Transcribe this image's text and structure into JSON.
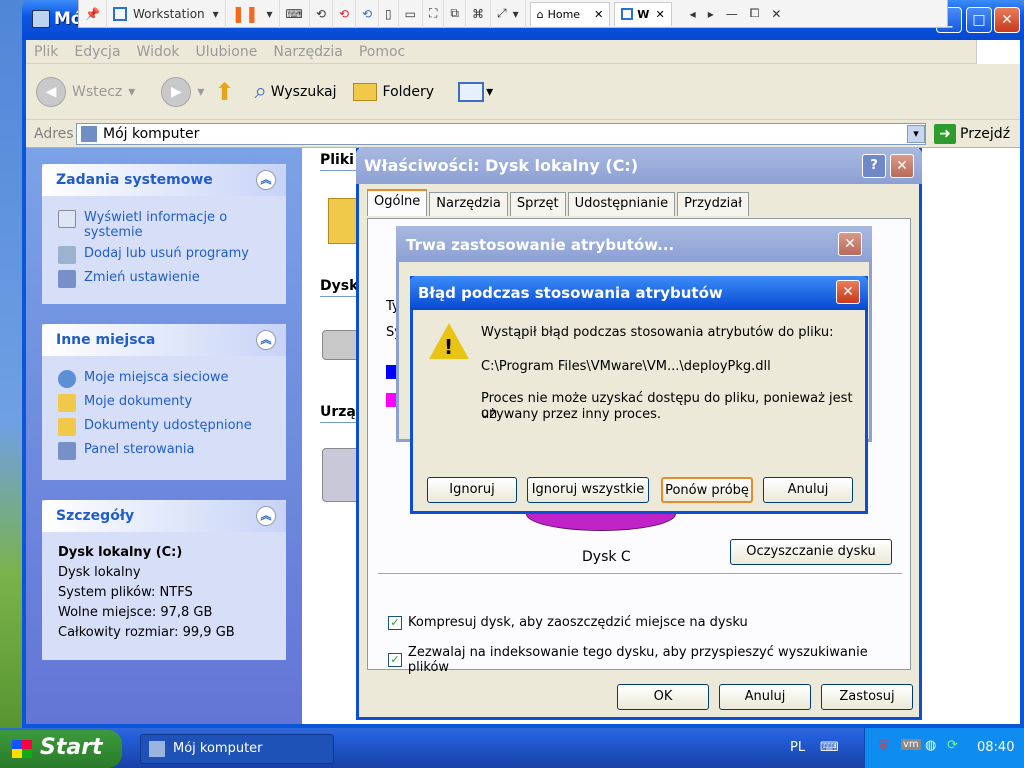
{
  "window": {
    "title": "Mó"
  },
  "vmware": {
    "vm_name": "Workstation",
    "tab_home": "Home",
    "tab_w": "W"
  },
  "menu": [
    "Plik",
    "Edycja",
    "Widok",
    "Ulubione",
    "Narzędzia",
    "Pomoc"
  ],
  "toolbar": {
    "back": "Wstecz",
    "search": "Wyszukaj",
    "folders": "Foldery"
  },
  "address": {
    "label": "Adres",
    "value": "Mój komputer",
    "go": "Przejdź"
  },
  "tasks": {
    "title": "Zadania systemowe",
    "items": [
      "Wyświetl informacje o systemie",
      "Dodaj lub usuń programy",
      "Zmień ustawienie"
    ]
  },
  "places": {
    "title": "Inne miejsca",
    "items": [
      "Moje miejsca sieciowe",
      "Moje dokumenty",
      "Dokumenty udostępnione",
      "Panel sterowania"
    ]
  },
  "details": {
    "title": "Szczegóły",
    "name": "Dysk lokalny (C:)",
    "type": "Dysk lokalny",
    "fs": "System plików: NTFS",
    "free": "Wolne miejsce: 97,8 GB",
    "total": "Całkowity rozmiar: 99,9 GB"
  },
  "content": {
    "files_header": "Pliki p",
    "drives_header": "Dysk",
    "devices_header": "Urzą"
  },
  "props": {
    "title": "Właściwości: Dysk lokalny (C:)",
    "tabs": [
      "Ogólne",
      "Narzędzia",
      "Sprzęt",
      "Udostępnianie",
      "Przydział"
    ],
    "drive_label": "Dysk C",
    "cleanup": "Oczyszczanie dysku",
    "compress": "Kompresuj dysk, aby zaoszczędzić miejsce na dysku",
    "index": "Zezwalaj na indeksowanie tego dysku, aby przyspieszyć wyszukiwanie plików",
    "ok": "OK",
    "cancel": "Anuluj",
    "apply": "Zastosuj",
    "hidden_t": "Ty",
    "hidden_s": "Sy"
  },
  "progress": {
    "title": "Trwa zastosowanie atrybutów..."
  },
  "error": {
    "title": "Błąd podczas stosowania atrybutów",
    "line1": "Wystąpił błąd podczas stosowania atrybutów do pliku:",
    "path": "C:\\Program Files\\VMware\\VM...\\deployPkg.dll",
    "line2": "Proces nie może uzyskać dostępu do pliku, ponieważ jest on",
    "line3": "używany przez inny proces.",
    "btn_ignore": "Ignoruj",
    "btn_ignore_all": "Ignoruj wszystkie",
    "btn_retry": "Ponów próbę",
    "btn_cancel": "Anuluj"
  },
  "taskbar": {
    "start": "Start",
    "item": "Mój komputer",
    "lang": "PL",
    "clock": "08:40"
  }
}
